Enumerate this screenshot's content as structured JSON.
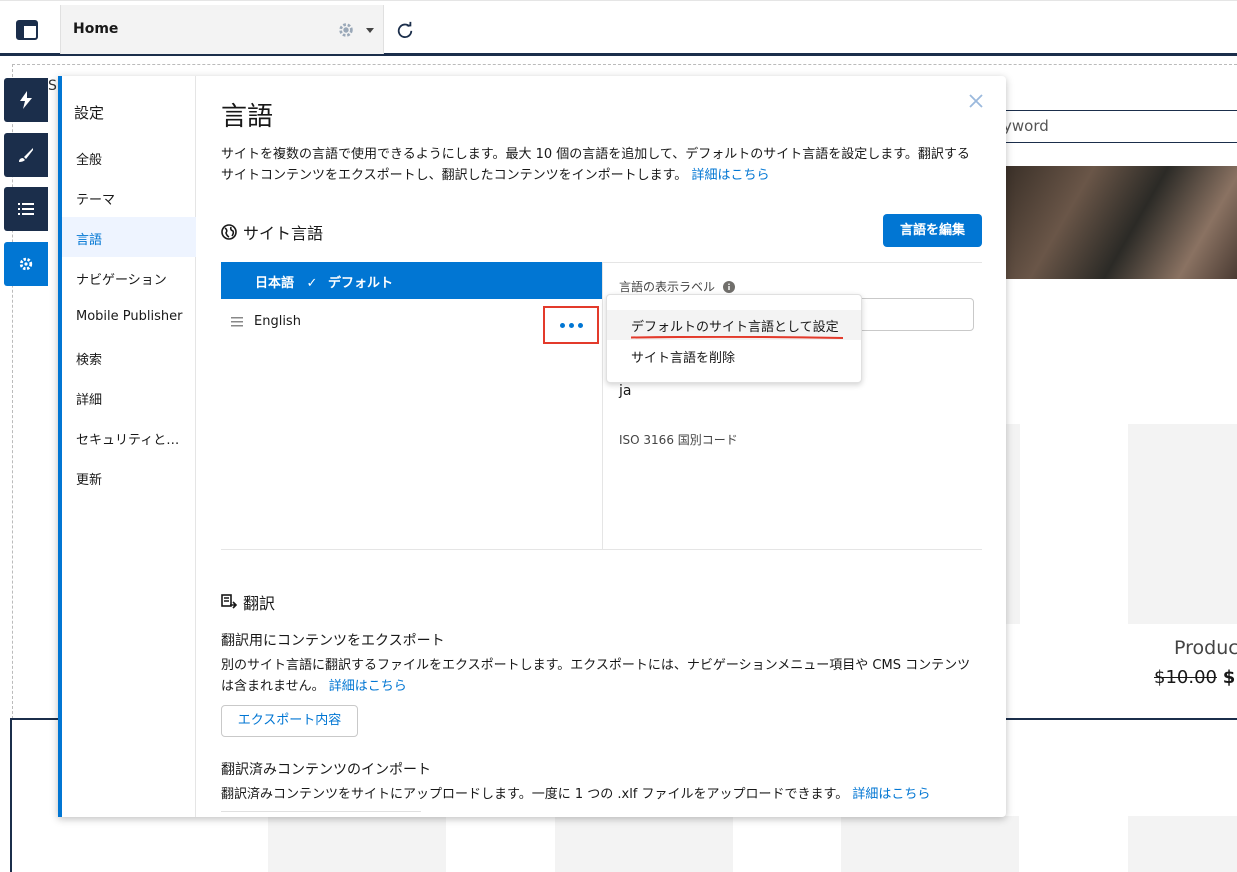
{
  "topbar": {
    "tab_label": "Home",
    "icons": [
      "layout-icon",
      "gear-icon",
      "chevron-down-icon",
      "refresh-icon"
    ]
  },
  "background": {
    "search_text": "yword",
    "product_label": "Produc",
    "price_old": "$10.00",
    "price_new": "$",
    "stray_letter": "S"
  },
  "toolbar": {
    "buttons": [
      "lightning-icon",
      "brush-icon",
      "list-icon",
      "gear-icon"
    ],
    "active_index": 3
  },
  "settings_nav": {
    "title": "設定",
    "items": [
      "全般",
      "テーマ",
      "言語",
      "ナビゲーション",
      "Mobile Publisher",
      "検索",
      "詳細",
      "セキュリティと…",
      "更新"
    ],
    "selected": "言語"
  },
  "language_panel": {
    "title": "言語",
    "description": "サイトを複数の言語で使用できるようにします。最大 10 個の言語を追加して、デフォルトのサイト言語を設定します。翻訳するサイトコンテンツをエクスポートし、翻訳したコンテンツをインポートします。",
    "learn_more": "詳細はこちら",
    "site_lang_heading": "サイト言語",
    "edit_button": "言語を編集",
    "languages": [
      {
        "name": "日本語",
        "badge": "デフォルト"
      },
      {
        "name": "English"
      }
    ],
    "display_label_field": "言語の表示ラベル",
    "code_value": "ja",
    "iso_label": "ISO 3166 国別コード",
    "menu": {
      "items": [
        "デフォルトのサイト言語として設定",
        "サイト言語を削除"
      ],
      "highlighted_index": 0
    },
    "translation": {
      "heading": "翻訳",
      "export_title": "翻訳用にコンテンツをエクスポート",
      "export_desc": "別のサイト言語に翻訳するファイルをエクスポートします。エクスポートには、ナビゲーションメニュー項目や CMS コンテンツは含まれません。",
      "export_link": "詳細はこちら",
      "export_button": "エクスポート内容",
      "import_title": "翻訳済みコンテンツのインポート",
      "import_desc": "翻訳済みコンテンツをサイトにアップロードします。一度に 1 つの .xlf ファイルをアップロードできます。",
      "import_link": "詳細はこちら"
    }
  },
  "colors": {
    "brand": "#0176d3",
    "navy": "#1b2e4b",
    "annotation_red": "#e33a2b"
  }
}
